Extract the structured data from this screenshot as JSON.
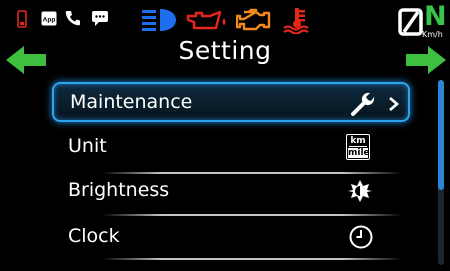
{
  "status_bar": {
    "icons": [
      "phone-battery-icon",
      "app-icon",
      "call-icon",
      "message-icon",
      "headlight-icon",
      "oil-pressure-icon",
      "engine-check-icon",
      "coolant-temp-icon"
    ],
    "colors": {
      "headlight": "#1e6ff0",
      "warning_red": "#e3261c",
      "warning_orange": "#f28a1b",
      "speed_green": "#37c24a"
    }
  },
  "app_label": "App",
  "speed": {
    "value": "N",
    "unit": "Km/h"
  },
  "title": "Setting",
  "menu": {
    "items": [
      {
        "label": "Maintenance",
        "icon": "wrench-icon",
        "selected": true
      },
      {
        "label": "Unit",
        "icon": "km-mile-icon"
      },
      {
        "label": "Brightness",
        "icon": "brightness-icon"
      },
      {
        "label": "Clock",
        "icon": "clock-icon"
      }
    ],
    "unit_icon_text": {
      "top": "km",
      "bottom": "mile"
    }
  },
  "colors": {
    "accent": "#2fa4ee",
    "arrow_green": "#3fbf3f"
  }
}
